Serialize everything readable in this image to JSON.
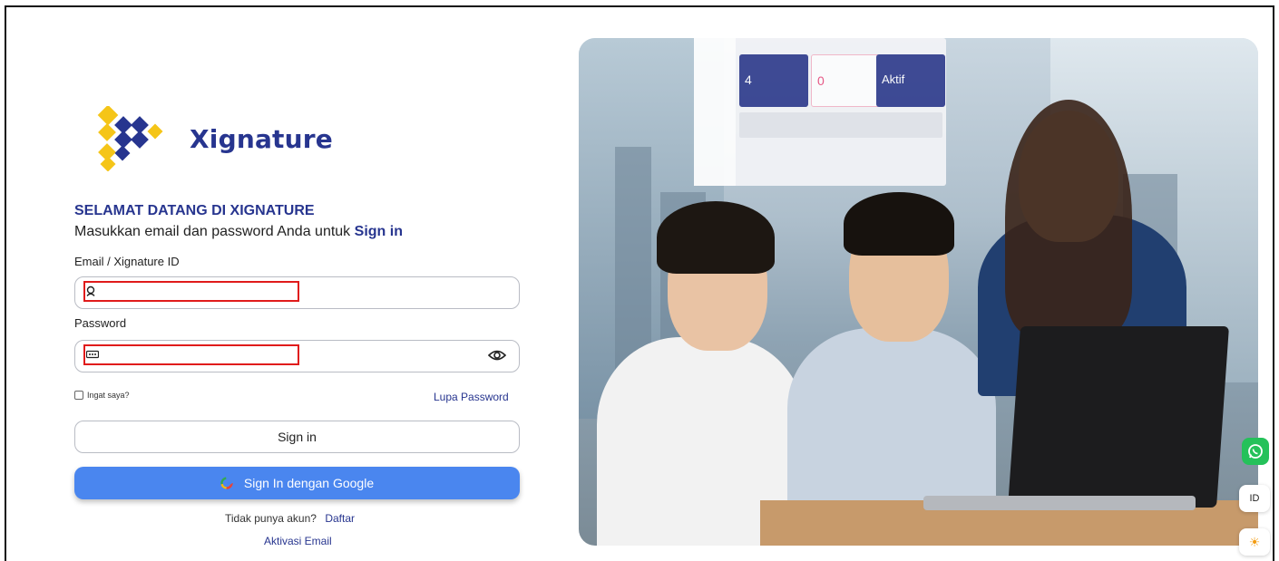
{
  "brand": {
    "name": "Xignature",
    "colors": {
      "primary": "#27358f",
      "accent": "#f5c518",
      "google_button": "#4a86ef",
      "highlight": "#e01b1b"
    }
  },
  "login": {
    "welcome": "SELAMAT DATANG DI XIGNATURE",
    "subtitle_prefix": "Masukkan email dan password Anda untuk",
    "subtitle_link": "Sign in",
    "email_label": "Email / Xignature ID",
    "email_icon": "user-icon",
    "email_value": "",
    "password_label": "Password",
    "password_icon": "key-icon",
    "password_value": "",
    "show_password_icon": "eye-icon",
    "remember_label": "Ingat saya?",
    "forgot_link": "Lupa Password",
    "signin_button": "Sign in",
    "google_button": "Sign In dengan Google",
    "no_account_text": "Tidak punya akun?",
    "register_link": "Daftar",
    "activate_link": "Aktivasi Email"
  },
  "hero_mock": {
    "card1_value": "4",
    "card2_value": "0",
    "card3_value": "Aktif"
  },
  "widgets": {
    "whatsapp_icon": "whatsapp-icon",
    "language": "ID",
    "theme_icon": "sun-icon"
  }
}
